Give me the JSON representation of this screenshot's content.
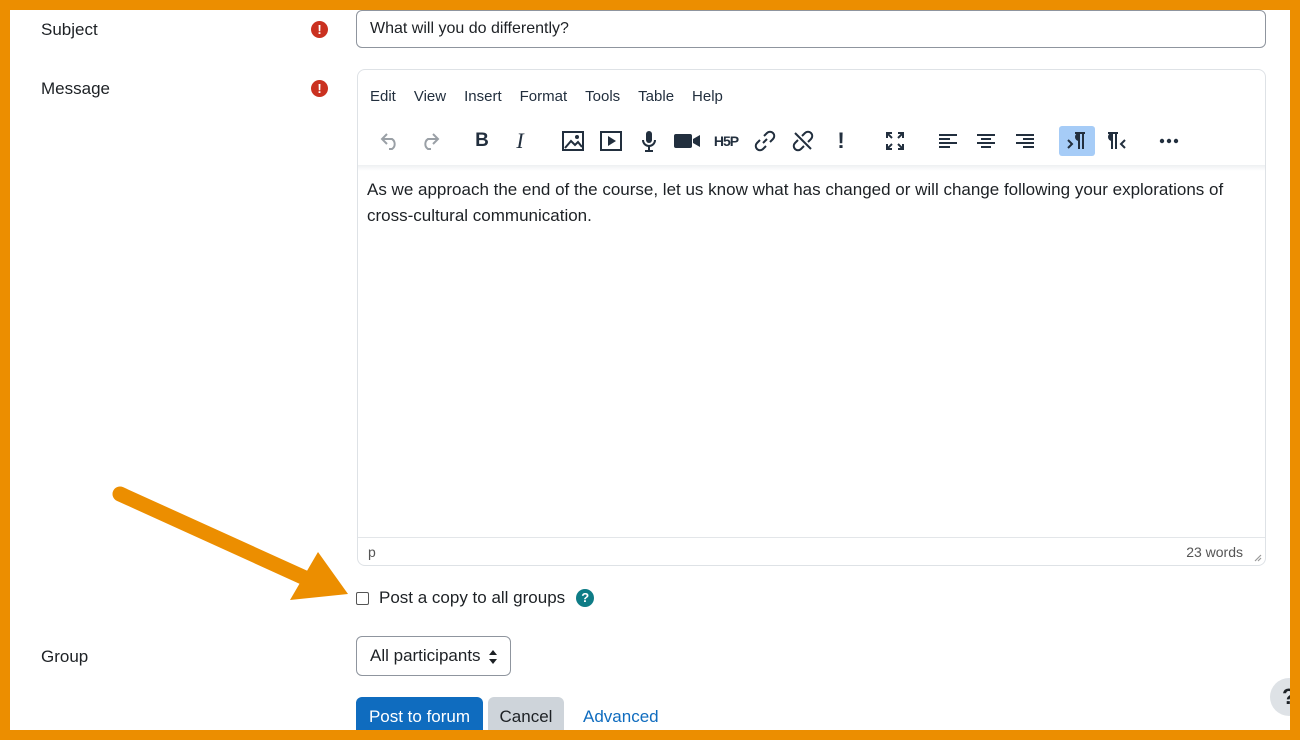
{
  "form": {
    "subject_label": "Subject",
    "subject_value": "What will you do differently?",
    "message_label": "Message",
    "group_label": "Group",
    "group_value": "All participants",
    "post_copy_label": "Post a copy to all groups",
    "required_mark": "!",
    "help_mark": "?"
  },
  "editor": {
    "menus": [
      "Edit",
      "View",
      "Insert",
      "Format",
      "Tools",
      "Table",
      "Help"
    ],
    "content": "As we approach the end of the course, let us know what has changed or will change following your explorations of cross-cultural communication.",
    "status_path": "p",
    "word_count": "23 words",
    "toolbar_icons": [
      "undo-icon",
      "redo-icon",
      "bold-icon",
      "italic-icon",
      "image-icon",
      "media-icon",
      "record-audio-icon",
      "record-video-icon",
      "h5p-icon",
      "link-icon",
      "unlink-icon",
      "exclamation-icon",
      "fullscreen-icon",
      "align-left-icon",
      "align-center-icon",
      "align-right-icon",
      "ltr-icon",
      "rtl-icon",
      "more-icon"
    ],
    "h5p_text": "H5P"
  },
  "actions": {
    "post_label": "Post to forum",
    "cancel_label": "Cancel",
    "advanced_label": "Advanced"
  },
  "colors": {
    "frame": "#EC8E00",
    "primary": "#0f6cbf",
    "required": "#ca3120"
  }
}
